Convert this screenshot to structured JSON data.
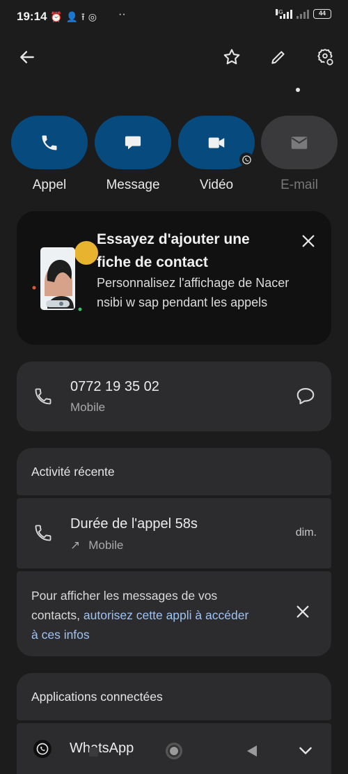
{
  "status_bar": {
    "time": "19:14",
    "icons": [
      "alarm-icon",
      "person-add-icon",
      "upload-icon",
      "instagram-icon",
      "more-dots-icon"
    ],
    "network": "4G",
    "battery": "44"
  },
  "toolbar": {
    "icons": [
      "back-arrow-icon",
      "star-icon",
      "edit-pencil-icon",
      "contact-settings-icon"
    ]
  },
  "actions": [
    {
      "label": "Appel",
      "icon": "phone-icon"
    },
    {
      "label": "Message",
      "icon": "chat-bubble-icon"
    },
    {
      "label": "Vidéo",
      "icon": "video-icon"
    },
    {
      "label": "E-mail",
      "icon": "mail-icon"
    }
  ],
  "promo": {
    "title": "Essayez d'ajouter une fiche de contact",
    "body": "Personnalisez l'affichage de Nacer nsibi w sap pendant les appels"
  },
  "phone": {
    "number": "0772 19 35 02",
    "type": "Mobile"
  },
  "recent_activity": {
    "title": "Activité récente",
    "call_title": "Durée de l'appel 58s",
    "call_type": "Mobile",
    "when": "dim."
  },
  "permission": {
    "text_prefix": "Pour afficher les messages de vos contacts, ",
    "link": "autorisez cette appli à accéder à ces infos"
  },
  "connected_apps": {
    "title": "Applications connectées",
    "app_name": "WhatsApp"
  },
  "colors": {
    "action_pill": "#074a7d",
    "background": "#1c1c1d",
    "card": "#2c2c2e",
    "link": "#9ec3f5"
  }
}
